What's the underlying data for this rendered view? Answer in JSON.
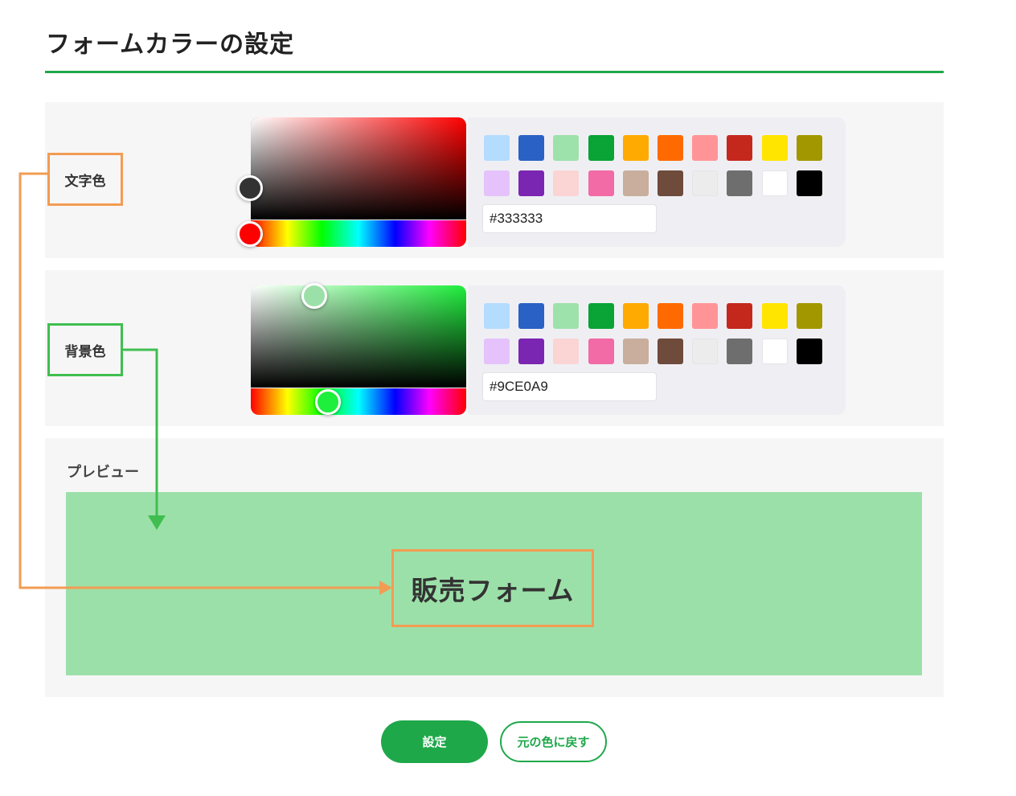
{
  "page": {
    "title": "フォームカラーの設定",
    "accent_color": "#1fa84a"
  },
  "text_color": {
    "label": "文字色",
    "value": "#333333",
    "hue_color": "#ff0000"
  },
  "background_color": {
    "label": "背景色",
    "value": "#9CE0A9",
    "hue_color": "#1eee3c"
  },
  "swatches": [
    "#b3dcff",
    "#2962c4",
    "#9de2ab",
    "#0aa336",
    "#ffaa00",
    "#ff6a00",
    "#ff9496",
    "#c4281d",
    "#ffe500",
    "#a39700",
    "#e5c2fb",
    "#7b25b3",
    "#fbd4d4",
    "#f26aa6",
    "#c9ae9d",
    "#6e4b3b",
    "#ececec",
    "#6e6e6e",
    "#ffffff",
    "#000000"
  ],
  "preview": {
    "label": "プレビュー",
    "form_title": "販売フォーム",
    "background": "#9ce0a9",
    "text_color": "#333333"
  },
  "buttons": {
    "set_label": "設定",
    "reset_label": "元の色に戻す"
  }
}
